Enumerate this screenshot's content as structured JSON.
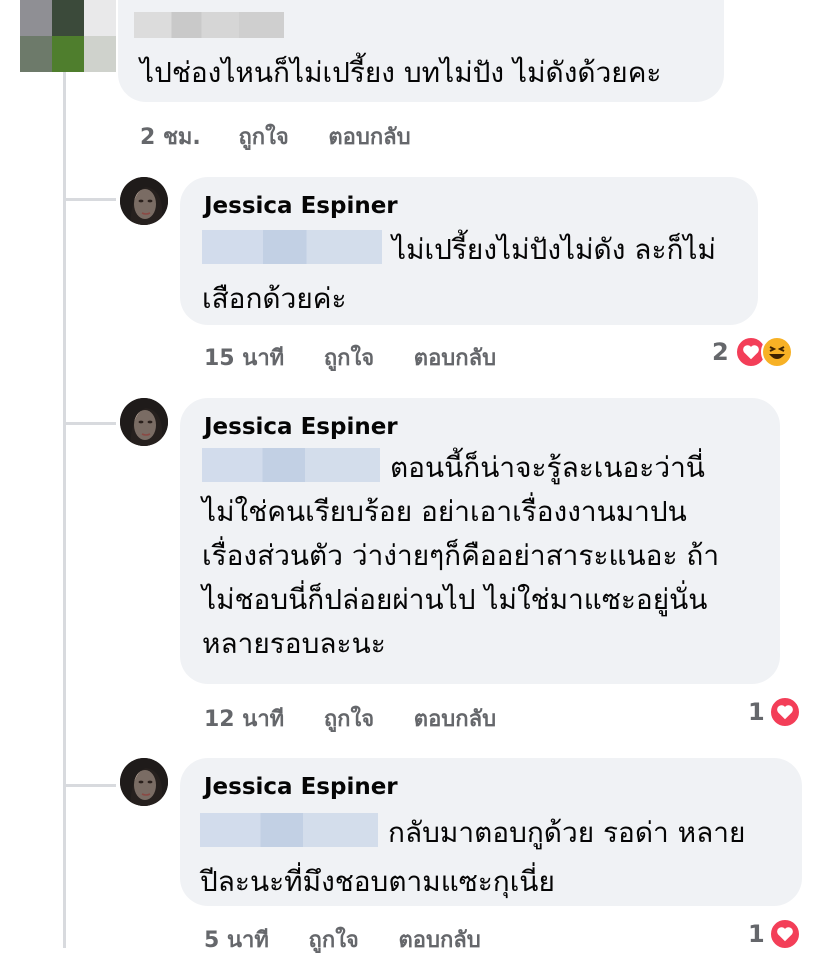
{
  "colors": {
    "bubble_bg": "#f0f2f5",
    "meta_text": "#65676b",
    "thread_line": "#d8dade",
    "heart": "#f33e58",
    "haha": "#f7b125"
  },
  "top_comment": {
    "text": "ไปช่องไหนก็ไม่เปรี้ยง บทไม่ปัง ไม่ดังด้วยคะ",
    "time": "2 ชม.",
    "like_label": "ถูกใจ",
    "reply_label": "ตอบกลับ"
  },
  "replies": [
    {
      "author": "Jessica Espiner",
      "lines": [
        "ไม่เปรี้ยงไม่ปังไม่ดัง ละก็ไม่",
        "เสือกด้วยค่ะ"
      ],
      "time": "15 นาที",
      "like_label": "ถูกใจ",
      "reply_label": "ตอบกลับ",
      "reaction_count": "2",
      "reactions": [
        "heart-icon",
        "haha-icon"
      ]
    },
    {
      "author": "Jessica Espiner",
      "lines": [
        "ตอนนี้ก็น่าจะรู้ละเนอะว่านี่",
        "ไม่ใช่คนเรียบร้อย อย่าเอาเรื่องงานมาปน",
        "เรื่องส่วนตัว ว่าง่ายๆก็คืออย่าสาระแนอะ ถ้า",
        "ไม่ชอบนี่ก็ปล่อยผ่านไป ไม่ใช่มาแซะอยู่นั่น",
        "หลายรอบละนะ"
      ],
      "time": "12 นาที",
      "like_label": "ถูกใจ",
      "reply_label": "ตอบกลับ",
      "reaction_count": "1",
      "reactions": [
        "heart-icon"
      ]
    },
    {
      "author": "Jessica Espiner",
      "lines": [
        "กลับมาตอบกูด้วย รอด่า หลาย",
        "ปีละนะที่มึงชอบตามแซะกุเนี่ย"
      ],
      "time": "5 นาที",
      "like_label": "ถูกใจ",
      "reply_label": "ตอบกลับ",
      "reaction_count": "1",
      "reactions": [
        "heart-icon"
      ]
    }
  ]
}
